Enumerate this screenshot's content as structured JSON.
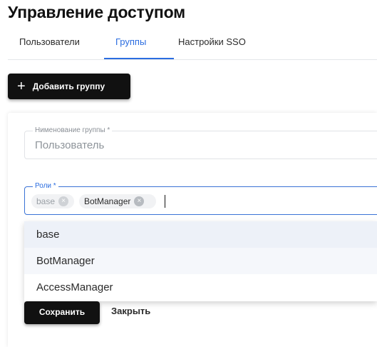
{
  "page": {
    "title": "Управление доступом"
  },
  "tabs": [
    {
      "label": "Пользователи",
      "active": false
    },
    {
      "label": "Группы",
      "active": true
    },
    {
      "label": "Настройки SSO",
      "active": false
    }
  ],
  "actions": {
    "add_group": "Добавить группу",
    "add_icon": "plus-icon"
  },
  "form": {
    "group_name": {
      "label": "Нименование группы *",
      "value": "Пользователь"
    },
    "roles": {
      "label": "Роли *",
      "chips": [
        {
          "label": "base"
        },
        {
          "label": "BotManager"
        }
      ]
    },
    "options": [
      "base",
      "BotManager",
      "AccessManager"
    ],
    "save_label": "Сохранить",
    "close_label": "Закрыть"
  },
  "colors": {
    "accent": "#2b6de0",
    "button_bg": "#111111"
  }
}
